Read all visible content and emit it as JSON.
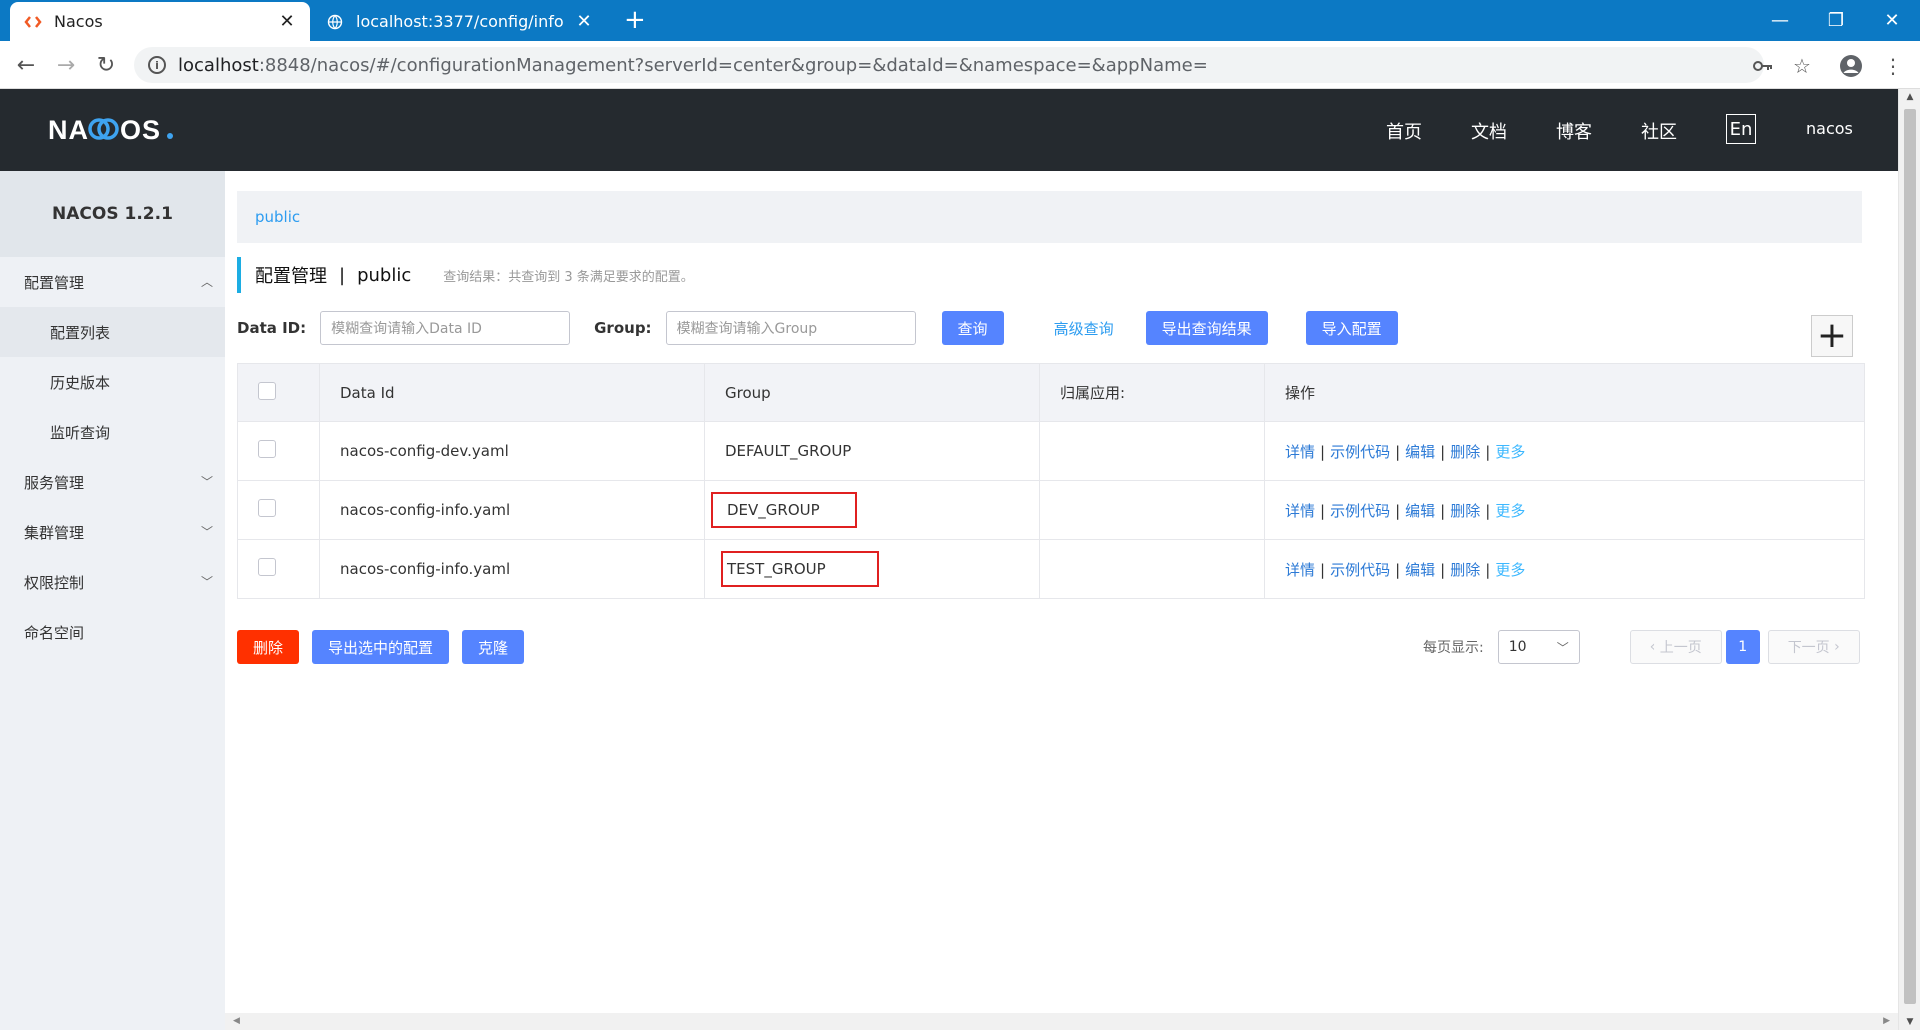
{
  "browser": {
    "tabs": [
      {
        "title": "Nacos",
        "active": true
      },
      {
        "title": "localhost:3377/config/info",
        "active": false
      }
    ],
    "url_host": "localhost",
    "url_rest": ":8848/nacos/#/configurationManagement?serverId=center&group=&dataId=&namespace=&appName="
  },
  "header": {
    "logo": "NACOS.",
    "nav": [
      "首页",
      "文档",
      "博客",
      "社区"
    ],
    "lang": "En",
    "user": "nacos"
  },
  "sidebar": {
    "version": "NACOS 1.2.1",
    "items": [
      {
        "label": "配置管理",
        "chevron": "^"
      },
      {
        "label": "配置列表",
        "sub": true
      },
      {
        "label": "历史版本",
        "sub": true
      },
      {
        "label": "监听查询",
        "sub": true
      },
      {
        "label": "服务管理",
        "chevron": "v"
      },
      {
        "label": "集群管理",
        "chevron": "v"
      },
      {
        "label": "权限控制",
        "chevron": "v"
      },
      {
        "label": "命名空间"
      }
    ]
  },
  "main": {
    "namespace_tab": "public",
    "title": "配置管理",
    "title_sep": "|",
    "title_ns": "public",
    "result_text": "查询结果：共查询到 3 条满足要求的配置。",
    "filters": {
      "data_id_label": "Data ID:",
      "data_id_placeholder": "模糊查询请输入Data ID",
      "group_label": "Group:",
      "group_placeholder": "模糊查询请输入Group",
      "query_btn": "查询",
      "advanced_link": "高级查询",
      "export_result_btn": "导出查询结果",
      "import_btn": "导入配置",
      "add_btn": "+"
    },
    "table": {
      "headers": [
        "Data Id",
        "Group",
        "归属应用:",
        "操作"
      ],
      "rows": [
        {
          "data_id": "nacos-config-dev.yaml",
          "group": "DEFAULT_GROUP",
          "app": ""
        },
        {
          "data_id": "nacos-config-info.yaml",
          "group": "DEV_GROUP",
          "app": ""
        },
        {
          "data_id": "nacos-config-info.yaml",
          "group": "TEST_GROUP",
          "app": ""
        }
      ],
      "ops": [
        "详情",
        "示例代码",
        "编辑",
        "删除",
        "更多"
      ],
      "ops_sep": "|"
    },
    "actions": {
      "delete_btn": "删除",
      "export_selected_btn": "导出选中的配置",
      "clone_btn": "克隆"
    },
    "pagination": {
      "page_size_label": "每页显示:",
      "page_size": "10",
      "prev": "上一页",
      "current": "1",
      "next": "下一页"
    }
  },
  "colors": {
    "chrome_blue": "#0c79c4",
    "header_bg": "#252a2f",
    "primary": "#5584ff",
    "danger": "#ff3000",
    "highlight_box": "#e02020"
  }
}
